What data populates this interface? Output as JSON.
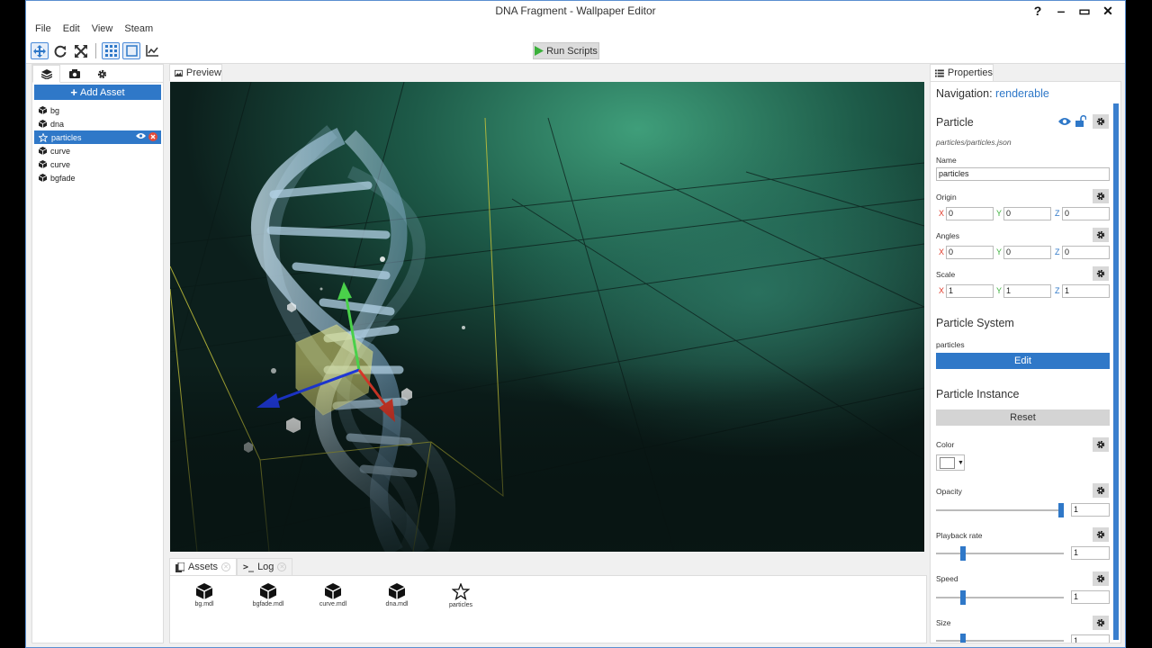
{
  "window": {
    "title": "DNA Fragment - Wallpaper Editor",
    "controls": [
      "?",
      "‒",
      "▭",
      "✕"
    ]
  },
  "menu": [
    "File",
    "Edit",
    "View",
    "Steam"
  ],
  "toolbar": {
    "run_scripts": "Run Scripts"
  },
  "left_panel": {
    "add_asset": "Add Asset",
    "items": [
      {
        "label": "bg",
        "icon": "cube-icon"
      },
      {
        "label": "dna",
        "icon": "cube-icon"
      },
      {
        "label": "particles",
        "icon": "star-icon",
        "selected": true
      },
      {
        "label": "curve",
        "icon": "cube-icon"
      },
      {
        "label": "curve",
        "icon": "cube-icon"
      },
      {
        "label": "bgfade",
        "icon": "cube-icon"
      }
    ]
  },
  "preview": {
    "tab_label": "Preview"
  },
  "bottom": {
    "tabs": [
      {
        "label": "Assets"
      },
      {
        "label": "Log"
      }
    ],
    "assets": [
      {
        "label": "bg.mdl",
        "icon": "cube-icon"
      },
      {
        "label": "bgfade.mdl",
        "icon": "cube-icon"
      },
      {
        "label": "curve.mdl",
        "icon": "cube-icon"
      },
      {
        "label": "dna.mdl",
        "icon": "cube-icon"
      },
      {
        "label": "particles",
        "icon": "star-icon"
      }
    ]
  },
  "properties": {
    "tab_label": "Properties",
    "navigation_label": "Navigation:",
    "navigation_link": "renderable",
    "section_title": "Particle",
    "file_path": "particles/particles.json",
    "name_label": "Name",
    "name_value": "particles",
    "origin": {
      "label": "Origin",
      "x": "0",
      "y": "0",
      "z": "0"
    },
    "angles": {
      "label": "Angles",
      "x": "0",
      "y": "0",
      "z": "0"
    },
    "scale": {
      "label": "Scale",
      "x": "1",
      "y": "1",
      "z": "1"
    },
    "axis_labels": {
      "x": "X",
      "y": "Y",
      "z": "Z"
    },
    "particle_system": {
      "title": "Particle System",
      "value": "particles",
      "edit": "Edit"
    },
    "particle_instance": {
      "title": "Particle Instance",
      "reset": "Reset"
    },
    "color": {
      "label": "Color",
      "value": "#ffffff"
    },
    "opacity": {
      "label": "Opacity",
      "value": "1",
      "fraction": 1.0
    },
    "playback_rate": {
      "label": "Playback rate",
      "value": "1",
      "fraction": 0.2
    },
    "speed": {
      "label": "Speed",
      "value": "1",
      "fraction": 0.2
    },
    "size": {
      "label": "Size",
      "value": "1",
      "fraction": 0.2
    }
  },
  "colors": {
    "accent": "#2f78c8",
    "run_green": "#3bb03b"
  }
}
